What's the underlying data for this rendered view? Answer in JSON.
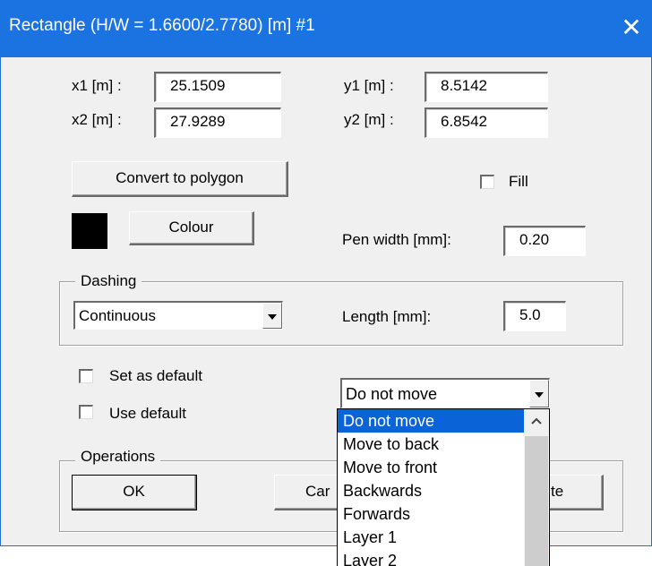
{
  "window": {
    "title": "Rectangle (H/W = 1.6600/2.7780) [m]   #1",
    "close_glyph": "✕"
  },
  "coords": {
    "x1_label": "x1 [m] :",
    "x1_value": "25.1509",
    "x2_label": "x2 [m] :",
    "x2_value": "27.9289",
    "y1_label": "y1 [m] :",
    "y1_value": "8.5142",
    "y2_label": "y2 [m] :",
    "y2_value": "6.8542"
  },
  "convert_button": "Convert to polygon",
  "fill_label": "Fill",
  "fill_checked": false,
  "colour": {
    "swatch": "#000000",
    "button": "Colour"
  },
  "pen_width": {
    "label": "Pen width [mm]:",
    "value": "0.20"
  },
  "dashing": {
    "caption": "Dashing",
    "selected": "Continuous",
    "length_label": "Length [mm]:",
    "length_value": "5.0"
  },
  "set_default_label": "Set as default",
  "use_default_label": "Use default",
  "order": {
    "selected": "Do not move",
    "options": [
      "Do not move",
      "Move to back",
      "Move to front",
      "Backwards",
      "Forwards",
      "Layer 1",
      "Layer 2"
    ],
    "highlighted_index": 0
  },
  "operations": {
    "caption": "Operations",
    "ok": "OK",
    "cancel_visible": "Car",
    "third_visible": "te"
  },
  "colors": {
    "title_bar": "#1a73e0",
    "selection": "#0a64d8",
    "dialog_bg": "#f0f0f0"
  }
}
